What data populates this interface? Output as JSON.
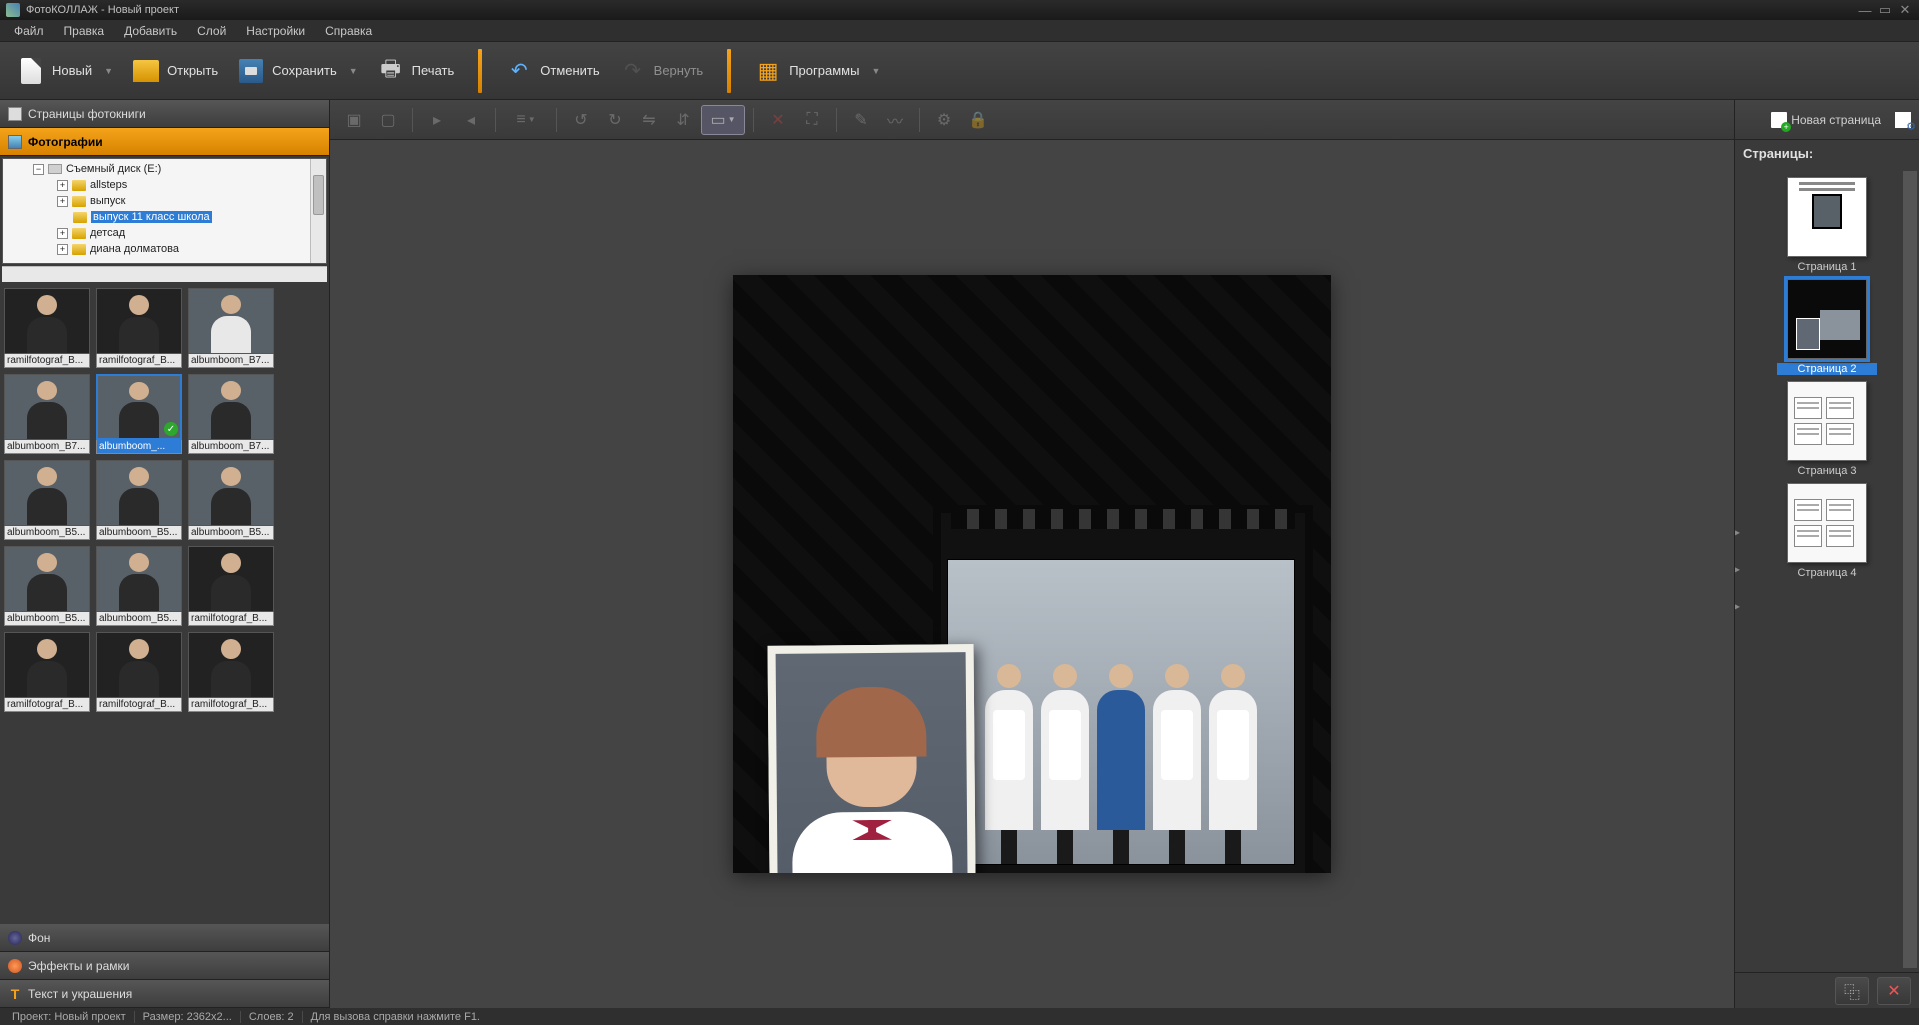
{
  "titlebar": {
    "text": "ФотоКОЛЛАЖ - Новый проект"
  },
  "menubar": {
    "items": [
      "Файл",
      "Правка",
      "Добавить",
      "Слой",
      "Настройки",
      "Справка"
    ]
  },
  "toolbar": {
    "new": "Новый",
    "open": "Открыть",
    "save": "Сохранить",
    "print": "Печать",
    "undo": "Отменить",
    "redo": "Вернуть",
    "apps": "Программы"
  },
  "left_panel": {
    "sections": {
      "pages": "Страницы фотокниги",
      "photos": "Фотографии",
      "background": "Фон",
      "effects": "Эффекты и рамки",
      "text": "Текст и украшения"
    },
    "tree": {
      "root": "Съемный диск (E:)",
      "children": [
        "allsteps",
        "выпуск",
        "выпуск 11 класс школа",
        "детсад",
        "диана долматова"
      ],
      "selected": "выпуск 11 класс школа"
    },
    "thumbs": [
      {
        "label": "ramilfotograf_B...",
        "style": "dark"
      },
      {
        "label": "ramilfotograf_B...",
        "style": "dark"
      },
      {
        "label": "albumboom_B7...",
        "style": "light"
      },
      {
        "label": "albumboom_B7...",
        "style": "portrait"
      },
      {
        "label": "albumboom_...",
        "style": "portrait",
        "selected": true,
        "checked": true
      },
      {
        "label": "albumboom_B7...",
        "style": "portrait"
      },
      {
        "label": "albumboom_B5...",
        "style": "portrait"
      },
      {
        "label": "albumboom_B5...",
        "style": "portrait"
      },
      {
        "label": "albumboom_B5...",
        "style": "portrait"
      },
      {
        "label": "albumboom_B5...",
        "style": "portrait"
      },
      {
        "label": "albumboom_B5...",
        "style": "portrait"
      },
      {
        "label": "ramilfotograf_B...",
        "style": "dark"
      },
      {
        "label": "ramilfotograf_B...",
        "style": "dark"
      },
      {
        "label": "ramilfotograf_B...",
        "style": "dark"
      },
      {
        "label": "ramilfotograf_B...",
        "style": "dark"
      }
    ]
  },
  "right_panel": {
    "new_page": "Новая страница",
    "header": "Страницы:",
    "pages": [
      "Страница 1",
      "Страница 2",
      "Страница 3",
      "Страница 4"
    ],
    "selected_index": 1
  },
  "statusbar": {
    "project": "Проект:  Новый проект",
    "size": "Размер:  2362x2...",
    "layers": "Слоев:  2",
    "help": "Для вызова справки нажмите F1."
  }
}
